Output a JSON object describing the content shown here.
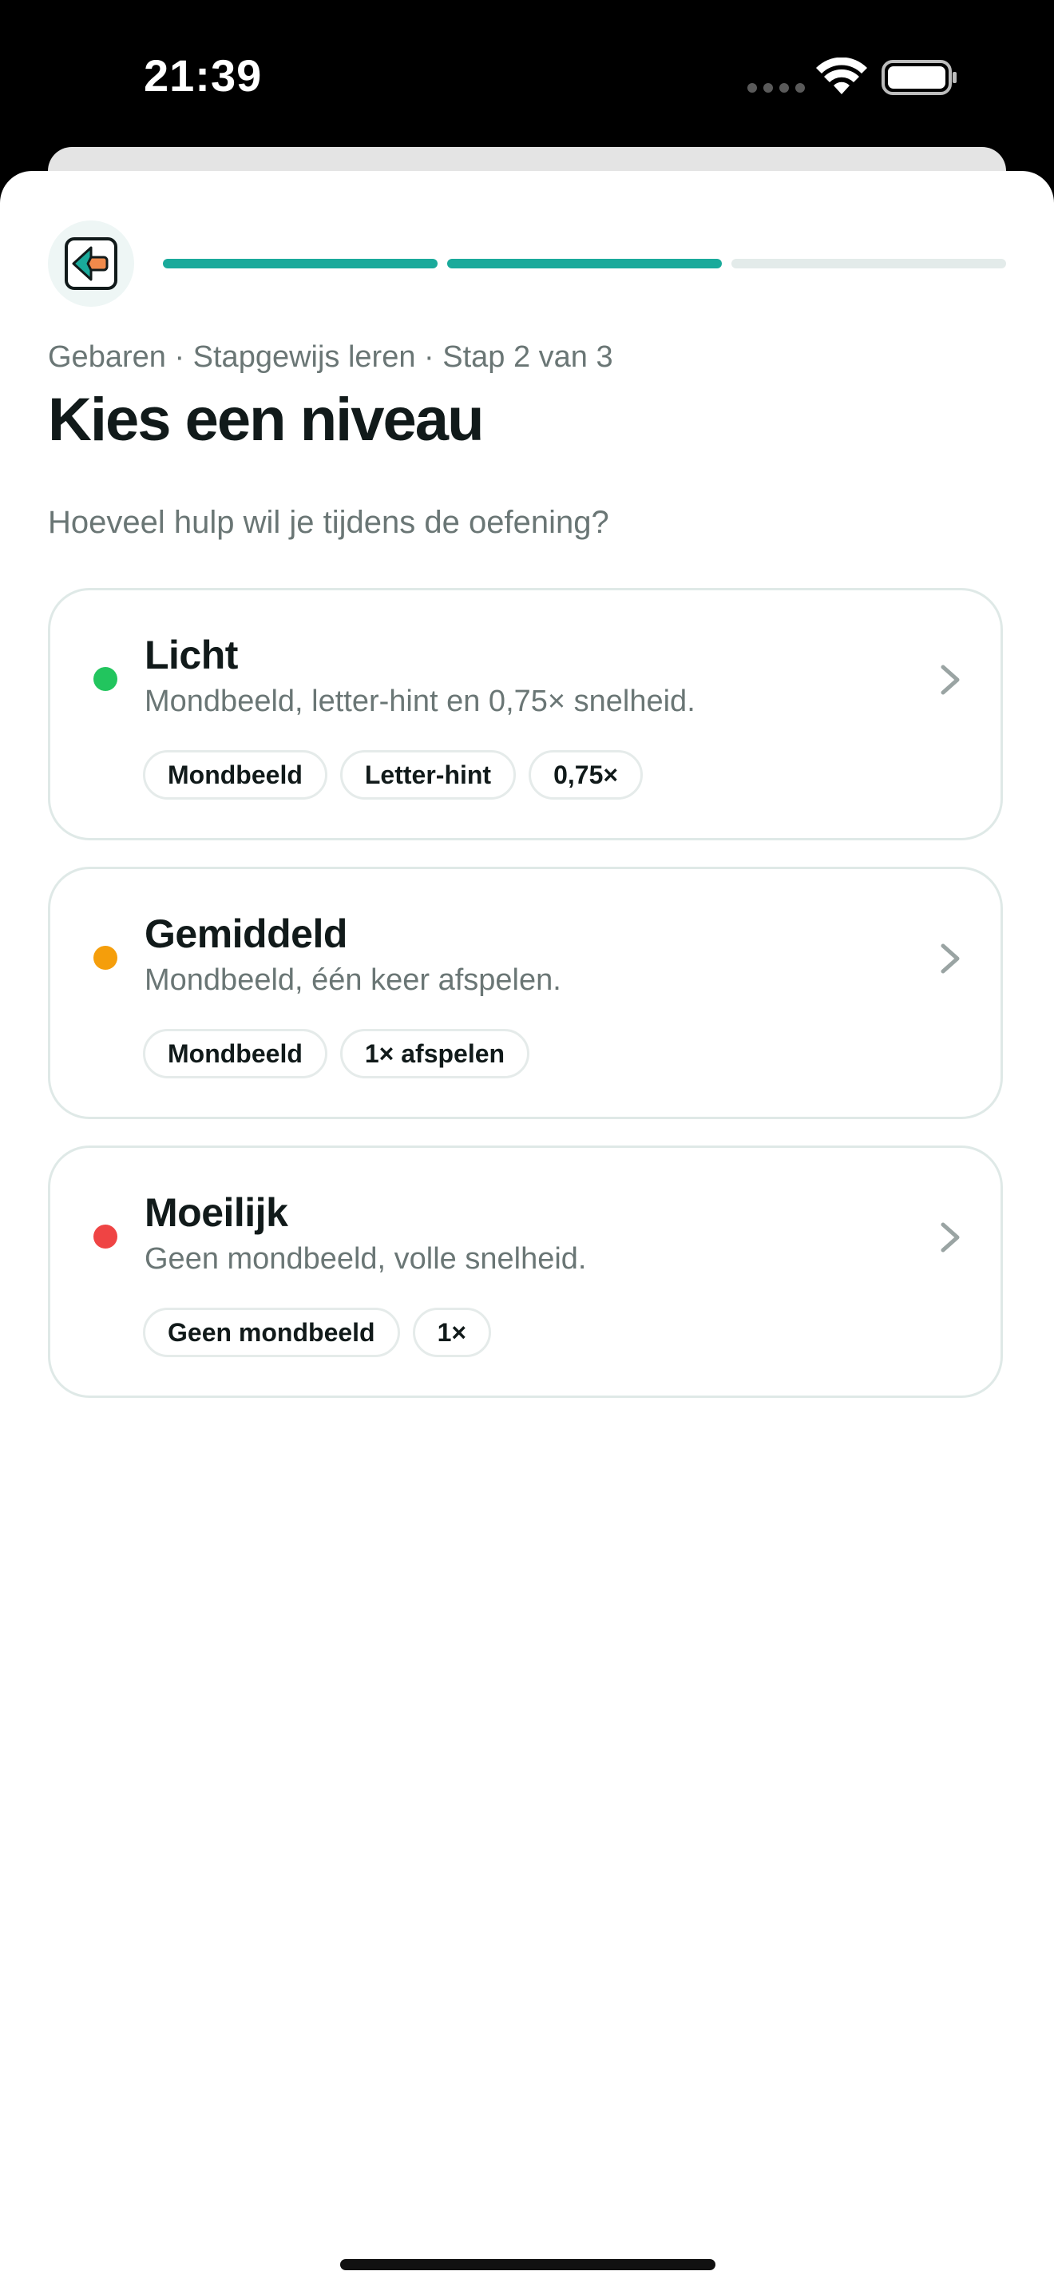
{
  "status_bar": {
    "time": "21:39"
  },
  "header": {
    "back_icon": "arrow-left-icon",
    "progress": {
      "total_steps": 3,
      "current_step": 2
    }
  },
  "breadcrumb": "Gebaren · Stapgewijs leren · Stap 2 van 3",
  "title": "Kies een niveau",
  "subtitle": "Hoeveel hulp wil je tijdens de oefening?",
  "levels": [
    {
      "title": "Licht",
      "description": "Mondbeeld, letter-hint en 0,75× snelheid.",
      "color": "#22c55e",
      "chips": [
        "Mondbeeld",
        "Letter-hint",
        "0,75×"
      ]
    },
    {
      "title": "Gemiddeld",
      "description": "Mondbeeld, één keer afspelen.",
      "color": "#f59e0b",
      "chips": [
        "Mondbeeld",
        "1× afspelen"
      ]
    },
    {
      "title": "Moeilijk",
      "description": "Geen mondbeeld, volle snelheid.",
      "color": "#ef4444",
      "chips": [
        "Geen mondbeeld",
        "1×"
      ]
    }
  ],
  "colors": {
    "accent": "#1aaa9b",
    "text_primary": "#111a1a",
    "text_secondary": "#6a7675"
  }
}
